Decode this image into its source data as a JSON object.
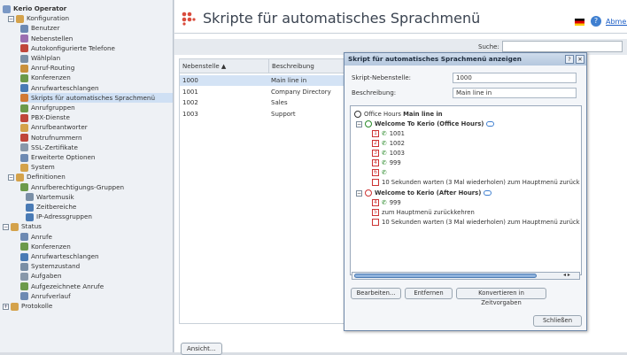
{
  "sidebar": {
    "items": [
      {
        "label": "Kerio Operator",
        "bold": true,
        "toggle": "",
        "color": "#7a98c5"
      },
      {
        "label": "Konfiguration",
        "toggle": "−",
        "color": "#d4a24b"
      },
      {
        "label": "Benutzer",
        "color": "#6d8ab3"
      },
      {
        "label": "Nebenstellen",
        "color": "#9b6fb0"
      },
      {
        "label": "Autokonfigurierte Telefone",
        "color": "#c0463b"
      },
      {
        "label": "Wählplan",
        "color": "#7a8fa6"
      },
      {
        "label": "Anruf-Routing",
        "color": "#c9903c"
      },
      {
        "label": "Konferenzen",
        "color": "#6c9a4a"
      },
      {
        "label": "Anrufwarteschlangen",
        "color": "#4a7bb5"
      },
      {
        "label": "Skripts für automatisches Sprachmenü",
        "color": "#d27a35"
      },
      {
        "label": "Anrufgruppen",
        "color": "#6c9a4a"
      },
      {
        "label": "PBX-Dienste",
        "color": "#c0463b"
      },
      {
        "label": "Anrufbeantworter",
        "color": "#d4a24b"
      },
      {
        "label": "Notrufnummern",
        "color": "#c0463b"
      },
      {
        "label": "SSL-Zertifikate",
        "color": "#8898aa"
      },
      {
        "label": "Erweiterte Optionen",
        "color": "#6d8ab3"
      },
      {
        "label": "System",
        "color": "#d4a24b"
      },
      {
        "label": "Definitionen",
        "toggle": "−",
        "color": "#d4a24b"
      },
      {
        "label": "Anrufberechtigungs-Gruppen",
        "color": "#6c9a4a"
      },
      {
        "label": "Wartemusik",
        "color": "#7a8fa6"
      },
      {
        "label": "Zeitbereiche",
        "color": "#4a7bb5"
      },
      {
        "label": "IP-Adressgruppen",
        "color": "#4a7bb5"
      },
      {
        "label": "Status",
        "toggle": "−",
        "color": "#d4a24b"
      },
      {
        "label": "Anrufe",
        "color": "#6d8ab3"
      },
      {
        "label": "Konferenzen",
        "color": "#6c9a4a"
      },
      {
        "label": "Anrufwarteschlangen",
        "color": "#4a7bb5"
      },
      {
        "label": "Systemzustand",
        "color": "#7a8fa6"
      },
      {
        "label": "Aufgaben",
        "color": "#8898aa"
      },
      {
        "label": "Aufgezeichnete Anrufe",
        "color": "#6c9a4a"
      },
      {
        "label": "Anrufverlauf",
        "color": "#6d8ab3"
      },
      {
        "label": "Protokolle",
        "toggle": "+",
        "color": "#d4a24b"
      }
    ]
  },
  "header": {
    "title": "Skripte für automatisches Sprachmenü",
    "logout": "Abmelden",
    "help": "?"
  },
  "search": {
    "label": "Suche:",
    "value": "",
    "placeholder": ""
  },
  "table": {
    "columns": [
      "Nebenstelle ▲",
      "Beschreibung"
    ],
    "rows": [
      [
        "1000",
        "Main line in"
      ],
      [
        "1001",
        "Company Directory"
      ],
      [
        "1002",
        "Sales"
      ],
      [
        "1003",
        "Support"
      ]
    ]
  },
  "view_button": "Ansicht...",
  "dialog": {
    "title": "Skript für automatisches Sprachmenü anzeigen",
    "help_btn": "?",
    "close_btn": "✕",
    "ext_label": "Skript-Nebenstelle:",
    "ext_value": "1000",
    "desc_label": "Beschreibung:",
    "desc_value": "Main line in",
    "tree_root_prefix": "Office Hours",
    "tree_root_bold": "Main line in",
    "welcome_office": "Welcome To Kerio (Office Hours)",
    "office_items": [
      {
        "key": "1",
        "text": "1001"
      },
      {
        "key": "2",
        "text": "1002"
      },
      {
        "key": "3",
        "text": "1003"
      },
      {
        "key": "4",
        "text": "999"
      },
      {
        "key": "6",
        "text": ""
      },
      {
        "key": "",
        "text": "10 Sekunden warten (3 Mal wiederholen) zum Hauptmenü zurück"
      }
    ],
    "welcome_after": "Welcome to Kerio (After Hours)",
    "after_items": [
      {
        "key": "4",
        "text": "999"
      },
      {
        "key": "5",
        "text": "zum Hauptmenü zurückkehren"
      },
      {
        "key": "",
        "text": "10 Sekunden warten (3 Mal wiederholen) zum Hauptmenü zurück"
      }
    ],
    "btn_edit": "Bearbeiten...",
    "btn_remove": "Entfernen",
    "btn_convert": "Konvertieren in Zeitvorgaben",
    "btn_close": "Schließen"
  }
}
